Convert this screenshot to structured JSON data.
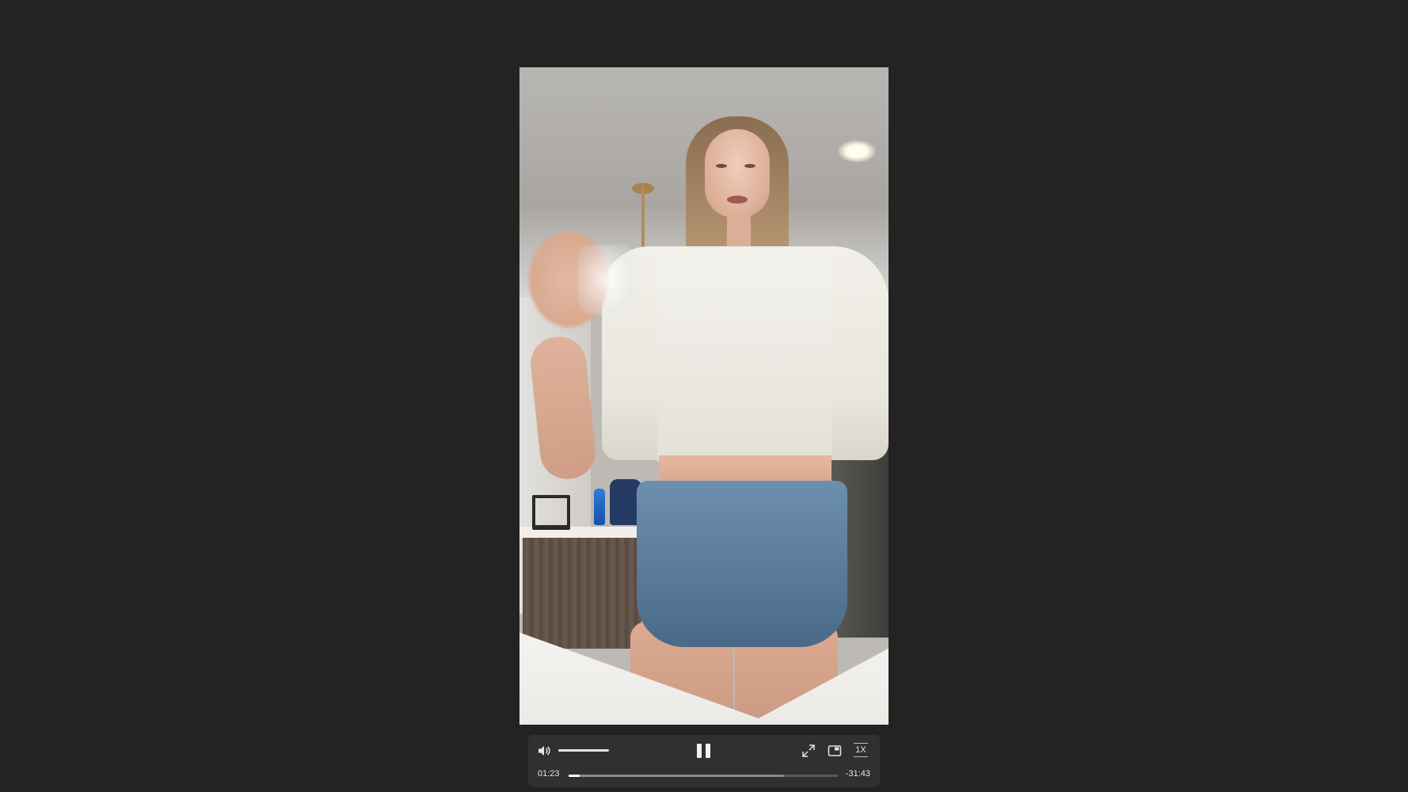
{
  "player": {
    "current_time": "01:23",
    "remaining_time": "-31:43",
    "playback_speed": "1X",
    "progress_fraction": 0.04,
    "buffered_fraction": 0.8,
    "volume_fraction": 1.0,
    "state": "playing"
  },
  "icons": {
    "volume": "speaker-icon",
    "pause": "pause-icon",
    "fullscreen": "expand-icon",
    "pip": "picture-in-picture-icon",
    "speed": "speed-icon"
  },
  "colors": {
    "background": "#232323",
    "controls_bg": "#303030",
    "progress_track": "#585858",
    "progress_fill": "#ffffff"
  }
}
